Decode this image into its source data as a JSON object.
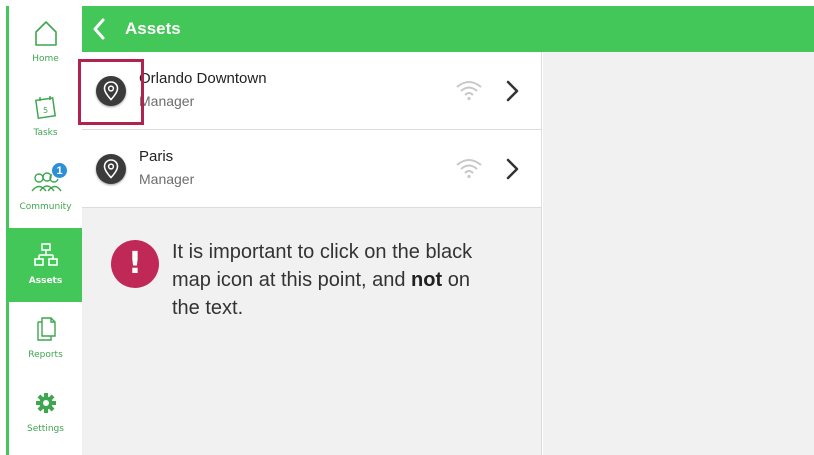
{
  "sidebar": {
    "items": [
      {
        "label": "Home",
        "icon": "home-icon"
      },
      {
        "label": "Tasks",
        "icon": "calendar-icon"
      },
      {
        "label": "Community",
        "icon": "people-icon",
        "badge": "1"
      },
      {
        "label": "Assets",
        "icon": "sitemap-icon",
        "active": true
      },
      {
        "label": "Reports",
        "icon": "documents-icon"
      },
      {
        "label": "Settings",
        "icon": "gear-icon"
      }
    ]
  },
  "header": {
    "title": "Assets"
  },
  "assets": [
    {
      "name": "Orlando Downtown",
      "role": "Manager"
    },
    {
      "name": "Paris",
      "role": "Manager"
    }
  ],
  "note": {
    "text_before": "It is important to click on the black map icon at this point, and ",
    "emphasis": "not",
    "text_after": " on the text."
  },
  "colors": {
    "accent": "#43c758",
    "highlight": "#b0234f",
    "alert": "#c02957",
    "badge": "#2d8fd5"
  }
}
